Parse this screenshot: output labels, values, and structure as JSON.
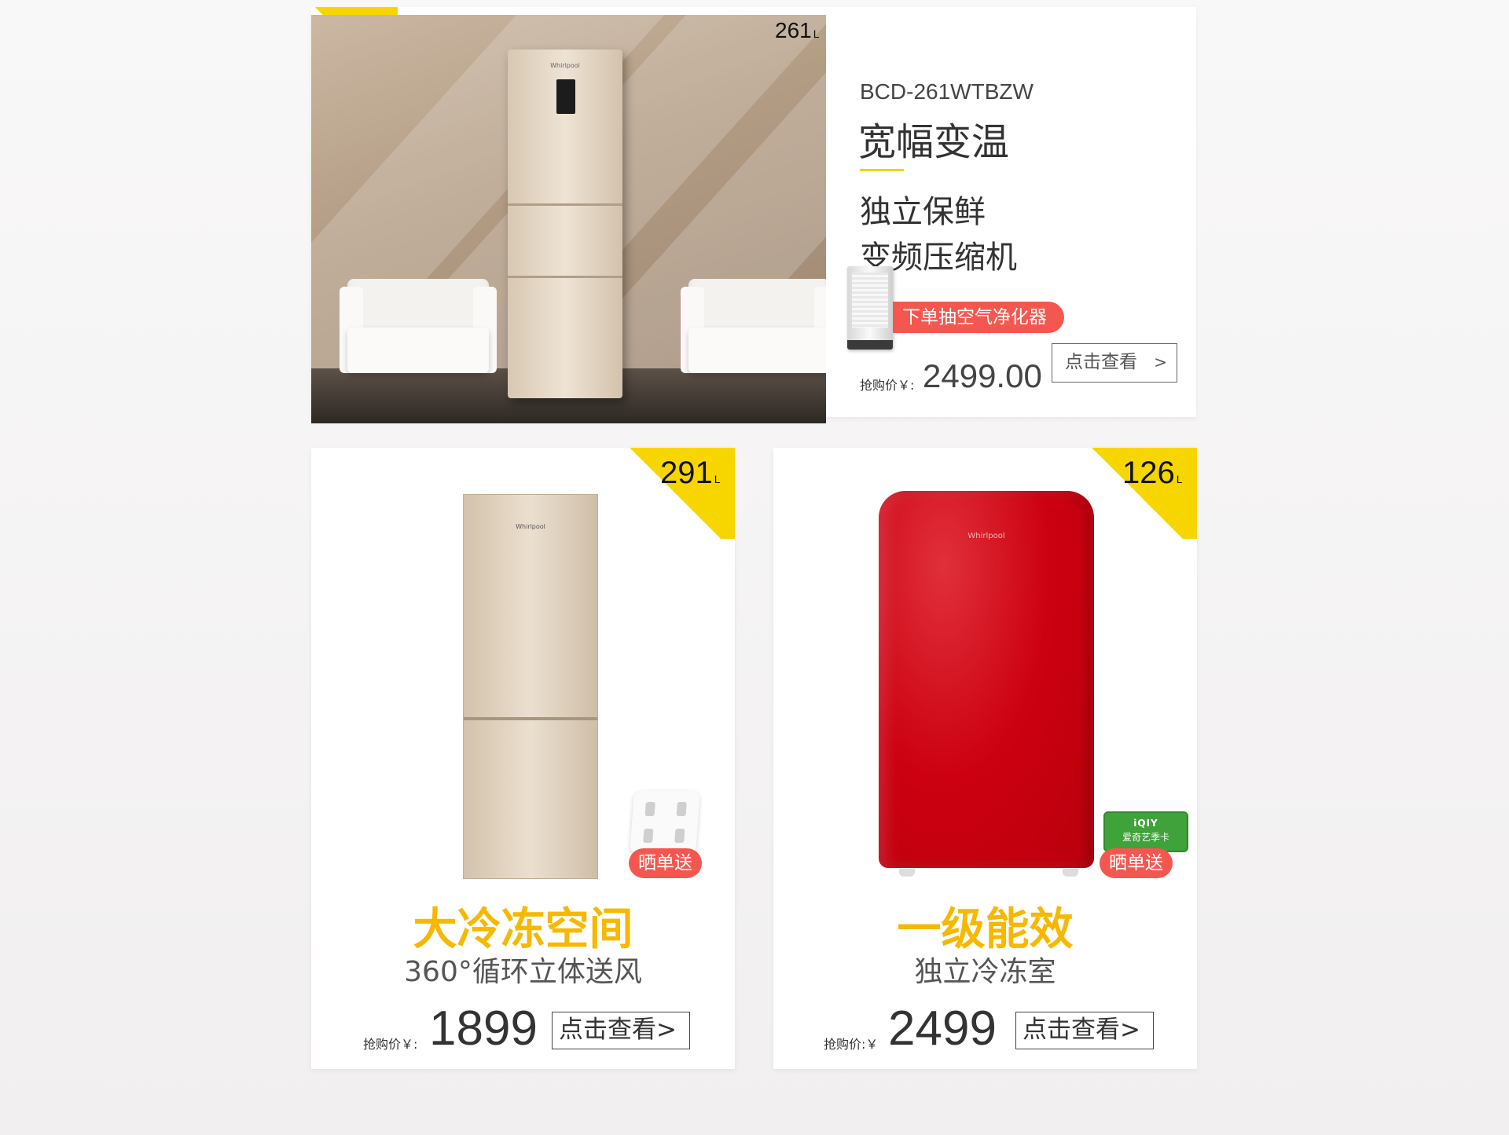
{
  "promo1": {
    "volume": "261",
    "unit": "L",
    "model": "BCD-261WTBZW",
    "headline": "宽幅变温",
    "feature1": "独立保鲜",
    "feature2": "变频压缩机",
    "gift": "下单抽空气净化器",
    "price_label": "抢购价￥:",
    "price": "2499.00",
    "button": "点击查看",
    "button_arrow": ">",
    "fridge_logo": "Whirlpool"
  },
  "promo2": {
    "volume": "291",
    "unit": "L",
    "headline": "大冷冻空间",
    "sub": "360°循环立体送风",
    "gift": "晒单送",
    "price_label": "抢购价￥:",
    "price": "1899",
    "button": "点击查看>",
    "fridge_logo": "Whirlpool"
  },
  "promo3": {
    "volume": "126",
    "unit": "L",
    "headline": "一级能效",
    "sub": "独立冷冻室",
    "gift": "晒单送",
    "gift_card_brand": "iQIY",
    "gift_card": "爱奇艺季卡",
    "price_label": "抢购价:￥",
    "price": "2499",
    "button": "点击查看>",
    "fridge_logo": "Whirlpool"
  },
  "colors": {
    "accent_yellow": "#f7d600",
    "headline_yellow": "#f6b800",
    "gift_red": "#f4574f",
    "fridge_red": "#cc0010"
  }
}
